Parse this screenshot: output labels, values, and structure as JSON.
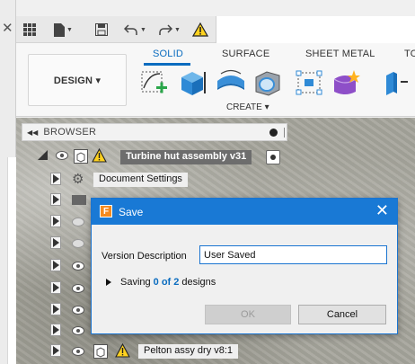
{
  "ribbon": {
    "design_label": "DESIGN ▾",
    "tabs": [
      "SOLID",
      "SURFACE",
      "SHEET METAL",
      "TO"
    ],
    "create_label": "CREATE ▾"
  },
  "browser": {
    "title": "BROWSER",
    "assembly_name": "Turbine hut assembly v31",
    "items": [
      {
        "label": "Document Settings"
      },
      {
        "label": "Pelton assy dry v8:1"
      }
    ]
  },
  "dialog": {
    "title": "Save",
    "close_glyph": "✕",
    "version_label": "Version Description",
    "version_value": "User Saved",
    "saving_prefix": "Saving",
    "saving_count": "0 of 2",
    "saving_suffix": "designs",
    "ok_label": "OK",
    "cancel_label": "Cancel"
  },
  "colors": {
    "accent": "#1979d5",
    "tab_active": "#0a6cbf",
    "dialog_icon": "#f58a1f"
  },
  "icons": [
    "grid-icon",
    "file-icon",
    "save-icon",
    "undo-icon",
    "redo-icon",
    "warning-icon",
    "sketch-icon",
    "box-icon",
    "revolve-icon",
    "shell-icon",
    "form-icon",
    "form-star-icon",
    "eye-icon",
    "component-icon",
    "gear-icon",
    "folder-icon",
    "target-icon",
    "fusion-icon"
  ]
}
